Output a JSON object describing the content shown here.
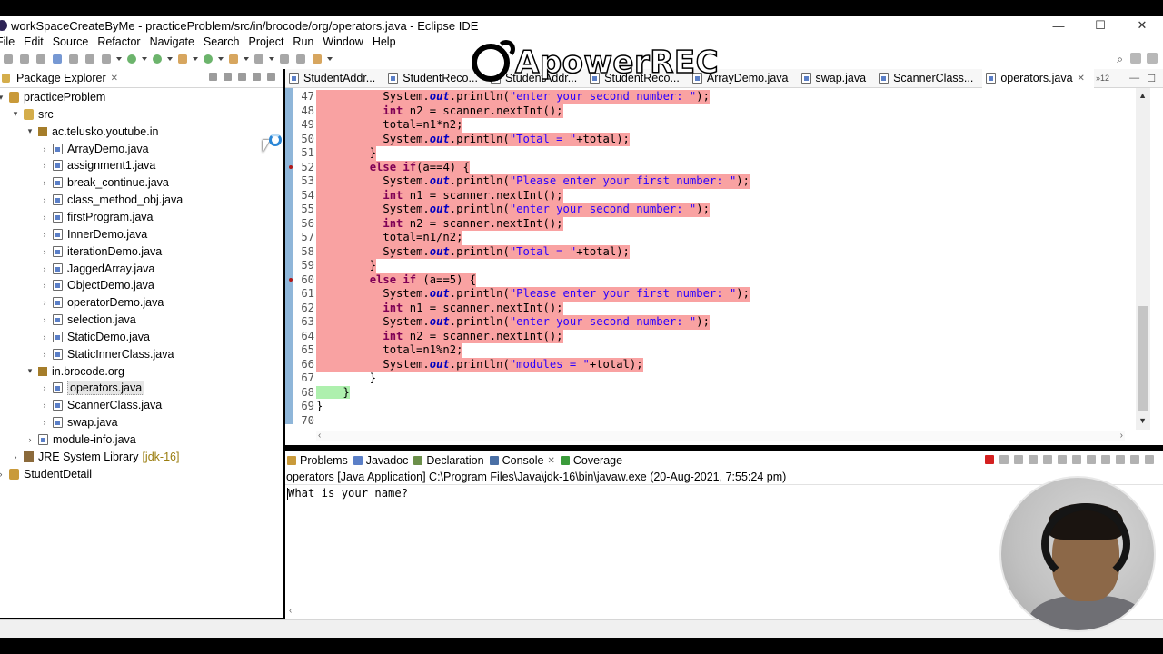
{
  "window": {
    "title": "workSpaceCreateByMe - practiceProblem/src/in/brocode/org/operators.java - Eclipse IDE",
    "minimize": "—",
    "maximize": "☐",
    "close": "✕"
  },
  "menu": [
    "File",
    "Edit",
    "Source",
    "Refactor",
    "Navigate",
    "Search",
    "Project",
    "Run",
    "Window",
    "Help"
  ],
  "watermark": {
    "text": "ApowerREC"
  },
  "package_explorer": {
    "title": "Package Explorer",
    "tree": [
      {
        "label": "practiceProblem",
        "depth": 0,
        "toggle": "▾",
        "icon": "project-icon",
        "row": 0
      },
      {
        "label": "src",
        "depth": 1,
        "toggle": "▾",
        "icon": "source-folder-icon",
        "row": 1
      },
      {
        "label": "ac.telusko.youtube.in",
        "depth": 2,
        "toggle": "▾",
        "icon": "package-icon",
        "row": 2
      },
      {
        "label": "ArrayDemo.java",
        "depth": 3,
        "toggle": "›",
        "icon": "java-file-icon",
        "row": 3
      },
      {
        "label": "assignment1.java",
        "depth": 3,
        "toggle": "›",
        "icon": "java-file-icon",
        "row": 4
      },
      {
        "label": "break_continue.java",
        "depth": 3,
        "toggle": "›",
        "icon": "java-file-icon",
        "row": 5
      },
      {
        "label": "class_method_obj.java",
        "depth": 3,
        "toggle": "›",
        "icon": "java-file-icon",
        "row": 6
      },
      {
        "label": "firstProgram.java",
        "depth": 3,
        "toggle": "›",
        "icon": "java-file-icon",
        "row": 7
      },
      {
        "label": "InnerDemo.java",
        "depth": 3,
        "toggle": "›",
        "icon": "java-file-icon",
        "row": 8
      },
      {
        "label": "iterationDemo.java",
        "depth": 3,
        "toggle": "›",
        "icon": "java-file-icon",
        "row": 9
      },
      {
        "label": "JaggedArray.java",
        "depth": 3,
        "toggle": "›",
        "icon": "java-file-icon",
        "row": 10
      },
      {
        "label": "ObjectDemo.java",
        "depth": 3,
        "toggle": "›",
        "icon": "java-file-icon",
        "row": 11
      },
      {
        "label": "operatorDemo.java",
        "depth": 3,
        "toggle": "›",
        "icon": "java-file-icon",
        "row": 12
      },
      {
        "label": "selection.java",
        "depth": 3,
        "toggle": "›",
        "icon": "java-file-icon",
        "row": 13
      },
      {
        "label": "StaticDemo.java",
        "depth": 3,
        "toggle": "›",
        "icon": "java-file-icon",
        "row": 14
      },
      {
        "label": "StaticInnerClass.java",
        "depth": 3,
        "toggle": "›",
        "icon": "java-file-icon",
        "row": 15
      },
      {
        "label": "in.brocode.org",
        "depth": 2,
        "toggle": "▾",
        "icon": "package-icon",
        "row": 16
      },
      {
        "label": "operators.java",
        "depth": 3,
        "toggle": "›",
        "icon": "java-file-icon",
        "row": 17,
        "selected": true
      },
      {
        "label": "ScannerClass.java",
        "depth": 3,
        "toggle": "›",
        "icon": "java-file-icon",
        "row": 18
      },
      {
        "label": "swap.java",
        "depth": 3,
        "toggle": "›",
        "icon": "java-file-icon",
        "row": 19
      },
      {
        "label": "module-info.java",
        "depth": 2,
        "toggle": "›",
        "icon": "java-file-icon",
        "row": 20
      },
      {
        "label": "JRE System Library",
        "extra": "[jdk-16]",
        "depth": 1,
        "toggle": "›",
        "icon": "library-icon",
        "row": 21
      },
      {
        "label": "StudentDetail",
        "depth": 0,
        "toggle": "›",
        "icon": "project-icon",
        "row": 22
      }
    ]
  },
  "editor": {
    "tabs": [
      {
        "label": "StudentAddr...",
        "active": false
      },
      {
        "label": "StudentReco...",
        "active": false
      },
      {
        "label": "StudentAddr...",
        "active": false
      },
      {
        "label": "StudentReco...",
        "active": false
      },
      {
        "label": "ArrayDemo.java",
        "active": false
      },
      {
        "label": "swap.java",
        "active": false
      },
      {
        "label": "ScannerClass...",
        "active": false
      },
      {
        "label": "operators.java",
        "active": true
      }
    ],
    "more_tabs": "»12",
    "lines": [
      {
        "n": "47",
        "hl": "red",
        "indent": 10,
        "tokens": [
          [
            "p",
            "System."
          ],
          [
            "f",
            "out"
          ],
          [
            "p",
            ".println("
          ],
          [
            "s",
            "\"enter your second number: \""
          ],
          [
            "p",
            ");"
          ]
        ]
      },
      {
        "n": "48",
        "hl": "red",
        "indent": 10,
        "tokens": [
          [
            "k",
            "int"
          ],
          [
            "p",
            " n2 = scanner.nextInt();"
          ]
        ]
      },
      {
        "n": "49",
        "hl": "red",
        "indent": 10,
        "tokens": [
          [
            "p",
            "total=n1*n2;"
          ]
        ]
      },
      {
        "n": "50",
        "hl": "red",
        "indent": 10,
        "tokens": [
          [
            "p",
            "System."
          ],
          [
            "f",
            "out"
          ],
          [
            "p",
            ".println("
          ],
          [
            "s",
            "\"Total = \""
          ],
          [
            "p",
            "+total);"
          ]
        ]
      },
      {
        "n": "51",
        "hl": "red",
        "indent": 8,
        "tokens": [
          [
            "p",
            "}"
          ]
        ]
      },
      {
        "n": "52",
        "hl": "red",
        "bp": true,
        "indent": 8,
        "tokens": [
          [
            "k",
            "else"
          ],
          [
            "p",
            " "
          ],
          [
            "k",
            "if"
          ],
          [
            "p",
            "(a==4) {"
          ]
        ]
      },
      {
        "n": "53",
        "hl": "red",
        "indent": 10,
        "tokens": [
          [
            "p",
            "System."
          ],
          [
            "f",
            "out"
          ],
          [
            "p",
            ".println("
          ],
          [
            "s",
            "\"Please enter your first number: \""
          ],
          [
            "p",
            ");"
          ]
        ]
      },
      {
        "n": "54",
        "hl": "red",
        "indent": 10,
        "tokens": [
          [
            "k",
            "int"
          ],
          [
            "p",
            " n1 = scanner.nextInt();"
          ]
        ]
      },
      {
        "n": "55",
        "hl": "red",
        "indent": 10,
        "tokens": [
          [
            "p",
            "System."
          ],
          [
            "f",
            "out"
          ],
          [
            "p",
            ".println("
          ],
          [
            "s",
            "\"enter your second number: \""
          ],
          [
            "p",
            ");"
          ]
        ]
      },
      {
        "n": "56",
        "hl": "red",
        "indent": 10,
        "tokens": [
          [
            "k",
            "int"
          ],
          [
            "p",
            " n2 = scanner.nextInt();"
          ]
        ]
      },
      {
        "n": "57",
        "hl": "red",
        "indent": 10,
        "tokens": [
          [
            "p",
            "total=n1/n2;"
          ]
        ]
      },
      {
        "n": "58",
        "hl": "red",
        "indent": 10,
        "tokens": [
          [
            "p",
            "System."
          ],
          [
            "f",
            "out"
          ],
          [
            "p",
            ".println("
          ],
          [
            "s",
            "\"Total = \""
          ],
          [
            "p",
            "+total);"
          ]
        ]
      },
      {
        "n": "59",
        "hl": "red",
        "indent": 8,
        "tokens": [
          [
            "p",
            "}"
          ]
        ]
      },
      {
        "n": "60",
        "hl": "red",
        "bp": true,
        "indent": 8,
        "tokens": [
          [
            "k",
            "else"
          ],
          [
            "p",
            " "
          ],
          [
            "k",
            "if"
          ],
          [
            "p",
            " (a==5) {"
          ]
        ]
      },
      {
        "n": "61",
        "hl": "red",
        "indent": 10,
        "tokens": [
          [
            "p",
            "System."
          ],
          [
            "f",
            "out"
          ],
          [
            "p",
            ".println("
          ],
          [
            "s",
            "\"Please enter your first number: \""
          ],
          [
            "p",
            ");"
          ]
        ]
      },
      {
        "n": "62",
        "hl": "red",
        "indent": 10,
        "tokens": [
          [
            "k",
            "int"
          ],
          [
            "p",
            " n1 = scanner.nextInt();"
          ]
        ]
      },
      {
        "n": "63",
        "hl": "red",
        "indent": 10,
        "tokens": [
          [
            "p",
            "System."
          ],
          [
            "f",
            "out"
          ],
          [
            "p",
            ".println("
          ],
          [
            "s",
            "\"enter your second number: \""
          ],
          [
            "p",
            ");"
          ]
        ]
      },
      {
        "n": "64",
        "hl": "red",
        "indent": 10,
        "tokens": [
          [
            "k",
            "int"
          ],
          [
            "p",
            " n2 = scanner.nextInt();"
          ]
        ]
      },
      {
        "n": "65",
        "hl": "red",
        "indent": 10,
        "tokens": [
          [
            "p",
            "total=n1%n2;"
          ]
        ]
      },
      {
        "n": "66",
        "hl": "red",
        "indent": 10,
        "tokens": [
          [
            "p",
            "System."
          ],
          [
            "f",
            "out"
          ],
          [
            "p",
            ".println("
          ],
          [
            "s",
            "\"modules = \""
          ],
          [
            "p",
            "+total);"
          ]
        ]
      },
      {
        "n": "67",
        "hl": "none",
        "indent": 8,
        "tokens": [
          [
            "p",
            "}"
          ]
        ]
      },
      {
        "n": "68",
        "hl": "green",
        "indent": 4,
        "tokens": [
          [
            "p",
            "}"
          ]
        ]
      },
      {
        "n": "69",
        "hl": "none",
        "indent": 0,
        "tokens": [
          [
            "p",
            "}"
          ]
        ]
      },
      {
        "n": "70",
        "hl": "none",
        "indent": 0,
        "tokens": []
      }
    ]
  },
  "console": {
    "tabs": [
      {
        "label": "Problems",
        "icon": "problems-icon",
        "color": "#c99a3a"
      },
      {
        "label": "Javadoc",
        "icon": "javadoc-icon",
        "color": "#5b7fc7"
      },
      {
        "label": "Declaration",
        "icon": "declaration-icon",
        "color": "#6b8f4a"
      },
      {
        "label": "Console",
        "icon": "console-icon",
        "color": "#4a6fa5",
        "active": true
      },
      {
        "label": "Coverage",
        "icon": "coverage-icon",
        "color": "#3b9b3b"
      }
    ],
    "info": "operators [Java Application] C:\\Program Files\\Java\\jdk-16\\bin\\javaw.exe  (20-Aug-2021, 7:55:24 pm)",
    "output": "What is your name?"
  },
  "colors": {
    "error_highlight": "#f9a2a2",
    "match_highlight": "#aef0ae",
    "keyword": "#7f0055",
    "string": "#2a00ff",
    "field": "#0000c0"
  }
}
